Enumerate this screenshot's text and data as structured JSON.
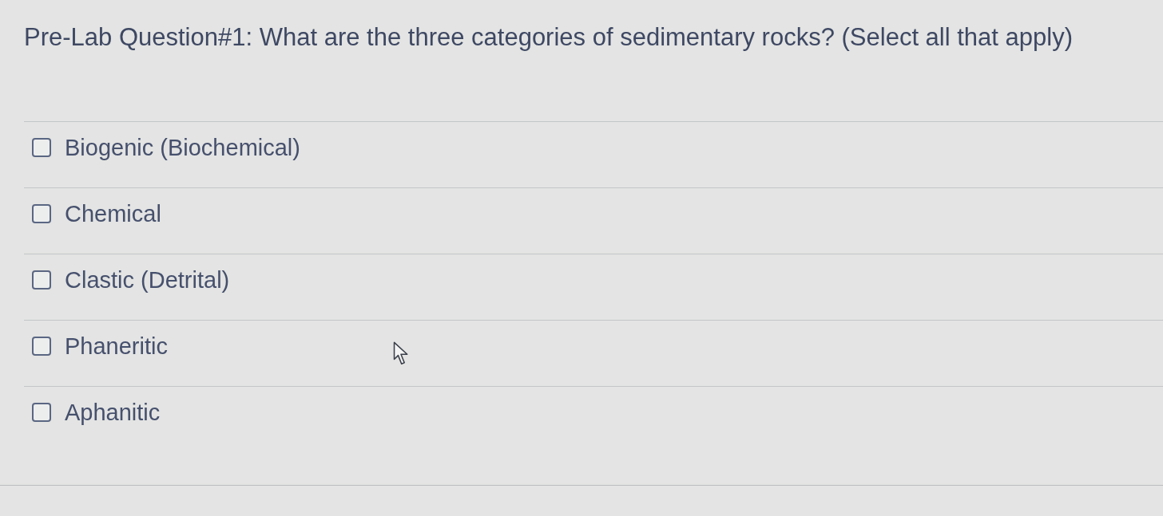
{
  "question": {
    "title": "Pre-Lab Question#1: What are the three categories of sedimentary rocks? (Select all that apply)"
  },
  "options": [
    {
      "label": "Biogenic (Biochemical)",
      "checked": false
    },
    {
      "label": "Chemical",
      "checked": false
    },
    {
      "label": "Clastic (Detrital)",
      "checked": false
    },
    {
      "label": "Phaneritic",
      "checked": false
    },
    {
      "label": "Aphanitic",
      "checked": false
    }
  ]
}
